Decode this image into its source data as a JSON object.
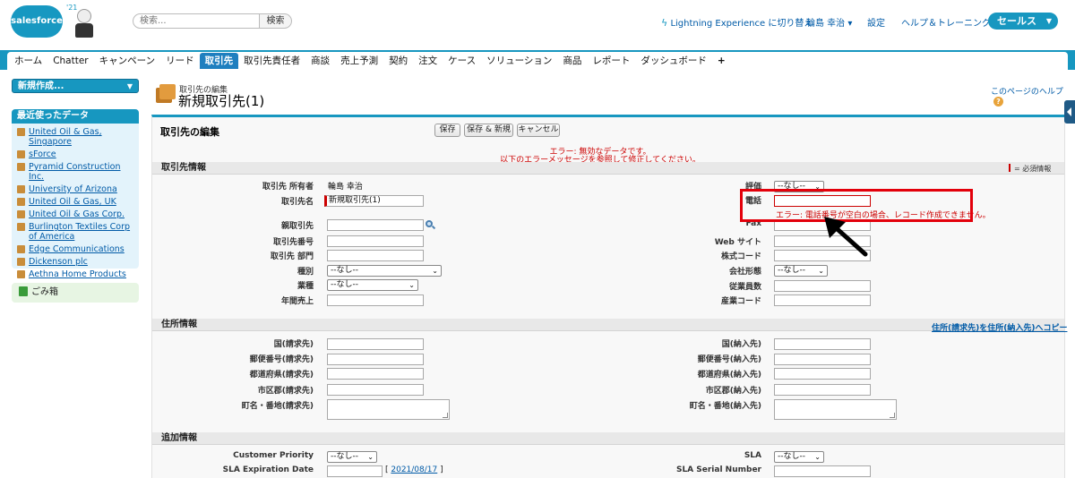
{
  "header": {
    "logo_text": "salesforce",
    "year_badge": "'21",
    "search_placeholder": "検索...",
    "search_button": "検索",
    "switch_link": "Lightning Experience に切り替え",
    "user_name": "輪島 幸治",
    "settings": "設定",
    "help_training": "ヘルプ＆トレーニング",
    "app_name": "セールス"
  },
  "tabs": [
    "ホーム",
    "Chatter",
    "キャンペーン",
    "リード",
    "取引先",
    "取引先責任者",
    "商談",
    "売上予測",
    "契約",
    "注文",
    "ケース",
    "ソリューション",
    "商品",
    "レポート",
    "ダッシュボード",
    "+"
  ],
  "active_tab": "取引先",
  "sidebar": {
    "create_new": "新規作成...",
    "recent_title": "最近使ったデータ",
    "recent_items": [
      "United Oil & Gas, Singapore",
      "sForce",
      "Pyramid Construction Inc.",
      "University of Arizona",
      "United Oil & Gas, UK",
      "United Oil & Gas Corp.",
      "Burlington Textiles Corp of America",
      "Edge Communications",
      "Dickenson plc",
      "Aethna Home Products"
    ],
    "recycle_bin": "ごみ箱"
  },
  "page": {
    "breadcrumb": "取引先の編集",
    "title": "新規取引先(1)",
    "help_link": "このページのヘルプ",
    "help_icon": "question-icon"
  },
  "form": {
    "title": "取引先の編集",
    "buttons": {
      "save": "保存",
      "save_new": "保存 & 新規",
      "cancel": "キャンセル"
    },
    "error_line1": "エラー: 無効なデータです。",
    "error_line2": "以下のエラーメッセージを参照して修正してください。",
    "required_legend": "= 必須情報",
    "section_account": "取引先情報",
    "section_address": "住所情報",
    "section_additional": "追加情報",
    "copy_address_link": "住所(請求先)を住所(納入先)へコピー",
    "account": {
      "owner_label": "取引先 所有者",
      "owner_value": "輪島 幸治",
      "name_label": "取引先名",
      "name_value": "新規取引先(1)",
      "parent_label": "親取引先",
      "number_label": "取引先番号",
      "site_label": "取引先 部門",
      "type_label": "種別",
      "type_value": "--なし--",
      "industry_label": "業種",
      "industry_value": "--なし--",
      "revenue_label": "年間売上",
      "rating_label": "評価",
      "rating_value": "--なし--",
      "phone_label": "電話",
      "phone_error": "エラー: 電話番号が空白の場合、レコード作成できません。",
      "fax_label": "Fax",
      "website_label": "Web サイト",
      "ticker_label": "株式コード",
      "ownership_label": "会社形態",
      "ownership_value": "--なし--",
      "employees_label": "従業員数",
      "sic_label": "産業コード"
    },
    "address": {
      "billing_country": "国(請求先)",
      "billing_zip": "郵便番号(請求先)",
      "billing_state": "都道府県(請求先)",
      "billing_city": "市区郡(請求先)",
      "billing_street": "町名・番地(請求先)",
      "shipping_country": "国(納入先)",
      "shipping_zip": "郵便番号(納入先)",
      "shipping_state": "都道府県(納入先)",
      "shipping_city": "市区郡(納入先)",
      "shipping_street": "町名・番地(納入先)"
    },
    "additional": {
      "priority_label": "Customer Priority",
      "priority_value": "--なし--",
      "sla_exp_label": "SLA Expiration Date",
      "sla_exp_date": "2021/08/17",
      "sla_label": "SLA",
      "sla_value": "--なし--",
      "sla_serial_label": "SLA Serial Number"
    }
  },
  "colors": {
    "brand": "#1797c0",
    "error": "#cc0000",
    "highlight": "#e3000b",
    "link": "#015ba7"
  }
}
